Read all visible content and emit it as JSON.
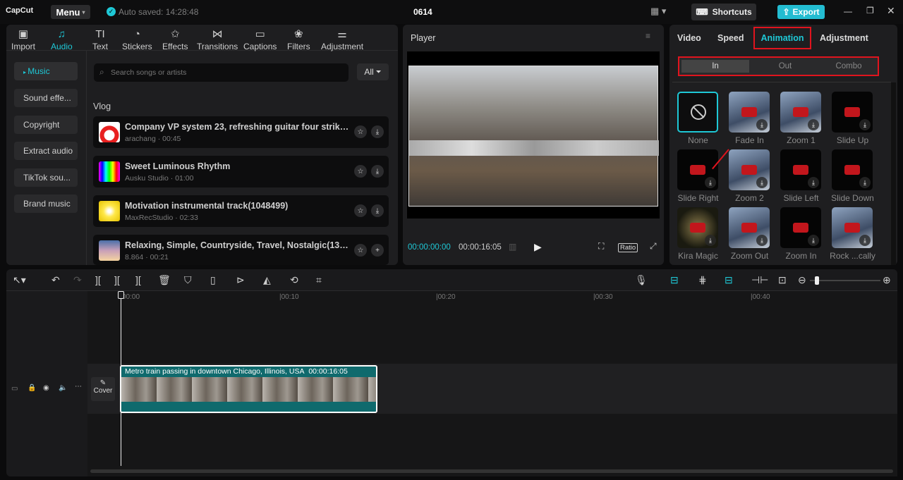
{
  "app": {
    "logo": "CapCut",
    "menu": "Menu",
    "autosave": "Auto saved: 14:28:48",
    "project": "0614",
    "shortcuts": "Shortcuts",
    "export": "Export"
  },
  "tabs": [
    {
      "label": "Import",
      "icon": "▣"
    },
    {
      "label": "Audio",
      "icon": "♫"
    },
    {
      "label": "Text",
      "icon": "TI"
    },
    {
      "label": "Stickers",
      "icon": "◔"
    },
    {
      "label": "Effects",
      "icon": "✩"
    },
    {
      "label": "Transitions",
      "icon": "⋈"
    },
    {
      "label": "Captions",
      "icon": "▭"
    },
    {
      "label": "Filters",
      "icon": "❀"
    },
    {
      "label": "Adjustment",
      "icon": "⚌"
    }
  ],
  "sidebar": [
    "Music",
    "Sound effe...",
    "Copyright",
    "Extract audio",
    "TikTok sou...",
    "Brand music"
  ],
  "search": {
    "placeholder": "Search songs or artists",
    "filter": "All"
  },
  "section": "Vlog",
  "tracks": [
    {
      "title": "Company VP system 23, refreshing guitar four strike...",
      "meta": "arachang · 00:45",
      "action": "download"
    },
    {
      "title": "Sweet Luminous Rhythm",
      "meta": "Ausku Studio · 01:00",
      "action": "download"
    },
    {
      "title": "Motivation instrumental track(1048499)",
      "meta": "MaxRecStudio · 02:33",
      "action": "download"
    },
    {
      "title": "Relaxing, Simple, Countryside, Travel, Nostalgic(1307...",
      "meta": "8.864 · 00:21",
      "action": "add"
    }
  ],
  "player": {
    "title": "Player",
    "current": "00:00:00:00",
    "total": "00:00:16:05",
    "ratio": "Ratio"
  },
  "right": {
    "tabs": [
      "Video",
      "Speed",
      "Animation",
      "Adjustment"
    ],
    "subtabs": [
      "In",
      "Out",
      "Combo"
    ],
    "animations": [
      "None",
      "Fade In",
      "Zoom 1",
      "Slide Up",
      "Slide Right",
      "Zoom 2",
      "Slide Left",
      "Slide Down",
      "Kira Magic",
      "Zoom Out",
      "Zoom In",
      "Rock ...cally"
    ]
  },
  "timeline": {
    "ticks": [
      "00:00",
      "|00:10",
      "|00:20",
      "|00:30",
      "|00:40"
    ],
    "clip_title": "Metro train passing in downtown Chicago, Illinois, USA",
    "clip_duration": "00:00:16:05",
    "cover": "Cover"
  },
  "colors": {
    "accent": "#1ec8d6",
    "highlight": "#e0141e"
  }
}
